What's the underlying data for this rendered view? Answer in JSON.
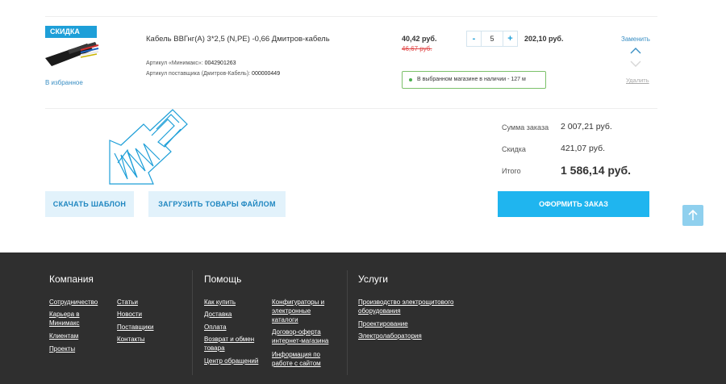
{
  "product": {
    "sale_badge": "СКИДКА",
    "favorites_link": "В избранное",
    "name": "Кабель ВВГнг(А) 3*2,5 (N,PE) -0,66 Дмитров-кабель",
    "article_minimaks_label": "Артикул «Минимакс»:",
    "article_minimaks_value": "0042901263",
    "article_supplier_label": "Артикул поставщика (Дмитров-Кабель):",
    "article_supplier_value": "000000449",
    "price": "40,42 руб.",
    "old_price": "46,67 руб.",
    "quantity": "5",
    "minus": "-",
    "plus": "+",
    "line_total": "202,10 руб.",
    "replace_link": "Заменить",
    "delete_link": "Удалить",
    "stock_status": "В выбранном магазине в наличии - 127 м"
  },
  "actions": {
    "download_template": "СКАЧАТЬ ШАБЛОН",
    "upload_file": "ЗАГРУЗИТЬ ТОВАРЫ ФАЙЛОМ",
    "checkout": "ОФОРМИТЬ ЗАКАЗ"
  },
  "summary": {
    "sum_label": "Сумма заказа",
    "sum_value": "2 007,21 руб.",
    "discount_label": "Скидка",
    "discount_value": "421,07 руб.",
    "total_label": "Итого",
    "total_value": "1 586,14 руб."
  },
  "footer": {
    "company": {
      "title": "Компания",
      "col1": [
        "Сотрудничество",
        "Карьера в Минимакс",
        "Клиентам",
        "Проекты"
      ],
      "col2": [
        "Статьи",
        "Новости",
        "Поставщики",
        "Контакты"
      ]
    },
    "help": {
      "title": "Помощь",
      "col1": [
        "Как купить",
        "Доставка",
        "Оплата",
        "Возврат и обмен товара",
        "Центр обращений"
      ],
      "col2": [
        "Конфигураторы и электронные каталоги",
        "Договор-оферта интернет-магазина",
        "Информация по работе с сайтом"
      ]
    },
    "services": {
      "title": "Услуги",
      "items": [
        "Производство электрощитового оборудования",
        "Проектирование",
        "Электролаборатория"
      ]
    }
  },
  "colors": {
    "accent": "#1fb5ef",
    "link": "#3a8fc4",
    "footer_bg": "#2f2f2f",
    "sale_red": "#e14b4b",
    "stock_green": "#7cc16a"
  }
}
